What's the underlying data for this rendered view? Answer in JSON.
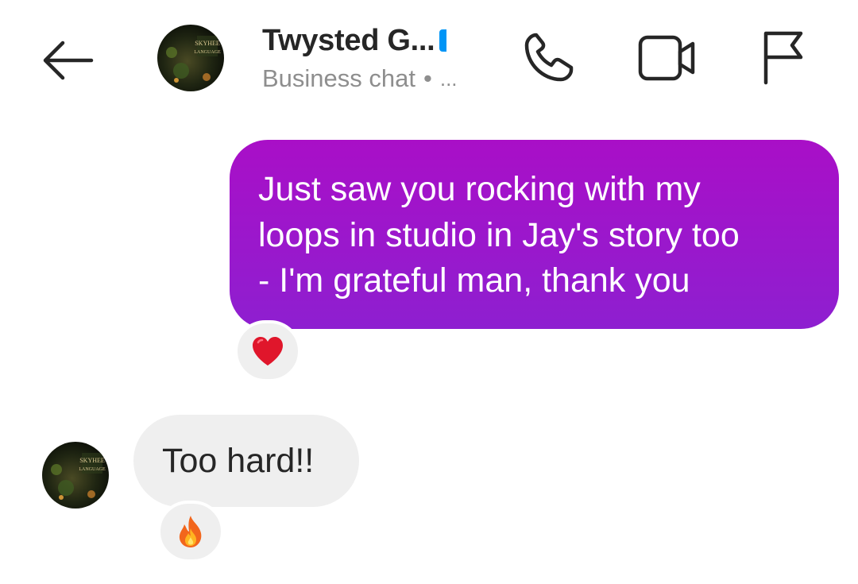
{
  "header": {
    "back_icon": "arrow-left-icon",
    "title": "Twysted G...",
    "verified_color": "#0095f6",
    "subtitle": "Business chat",
    "subtitle_separator": "•",
    "subtitle_more": "...",
    "avatar_text": "SKYHEE LANGUAGE",
    "actions": [
      {
        "icon": "phone-icon"
      },
      {
        "icon": "video-camera-icon"
      },
      {
        "icon": "flag-icon"
      }
    ]
  },
  "messages": [
    {
      "direction": "outgoing",
      "lines": [
        "Just saw you rocking with my",
        "loops in studio in Jay's story too",
        "- I'm grateful man, thank you"
      ],
      "reaction": "❤️",
      "reaction_icon": "heart-icon",
      "bubble_gradient": [
        "#a90fc7",
        "#8e1fd0"
      ]
    },
    {
      "direction": "incoming",
      "text": "Too hard!!",
      "reaction": "🔥",
      "reaction_icon": "fire-icon"
    }
  ]
}
